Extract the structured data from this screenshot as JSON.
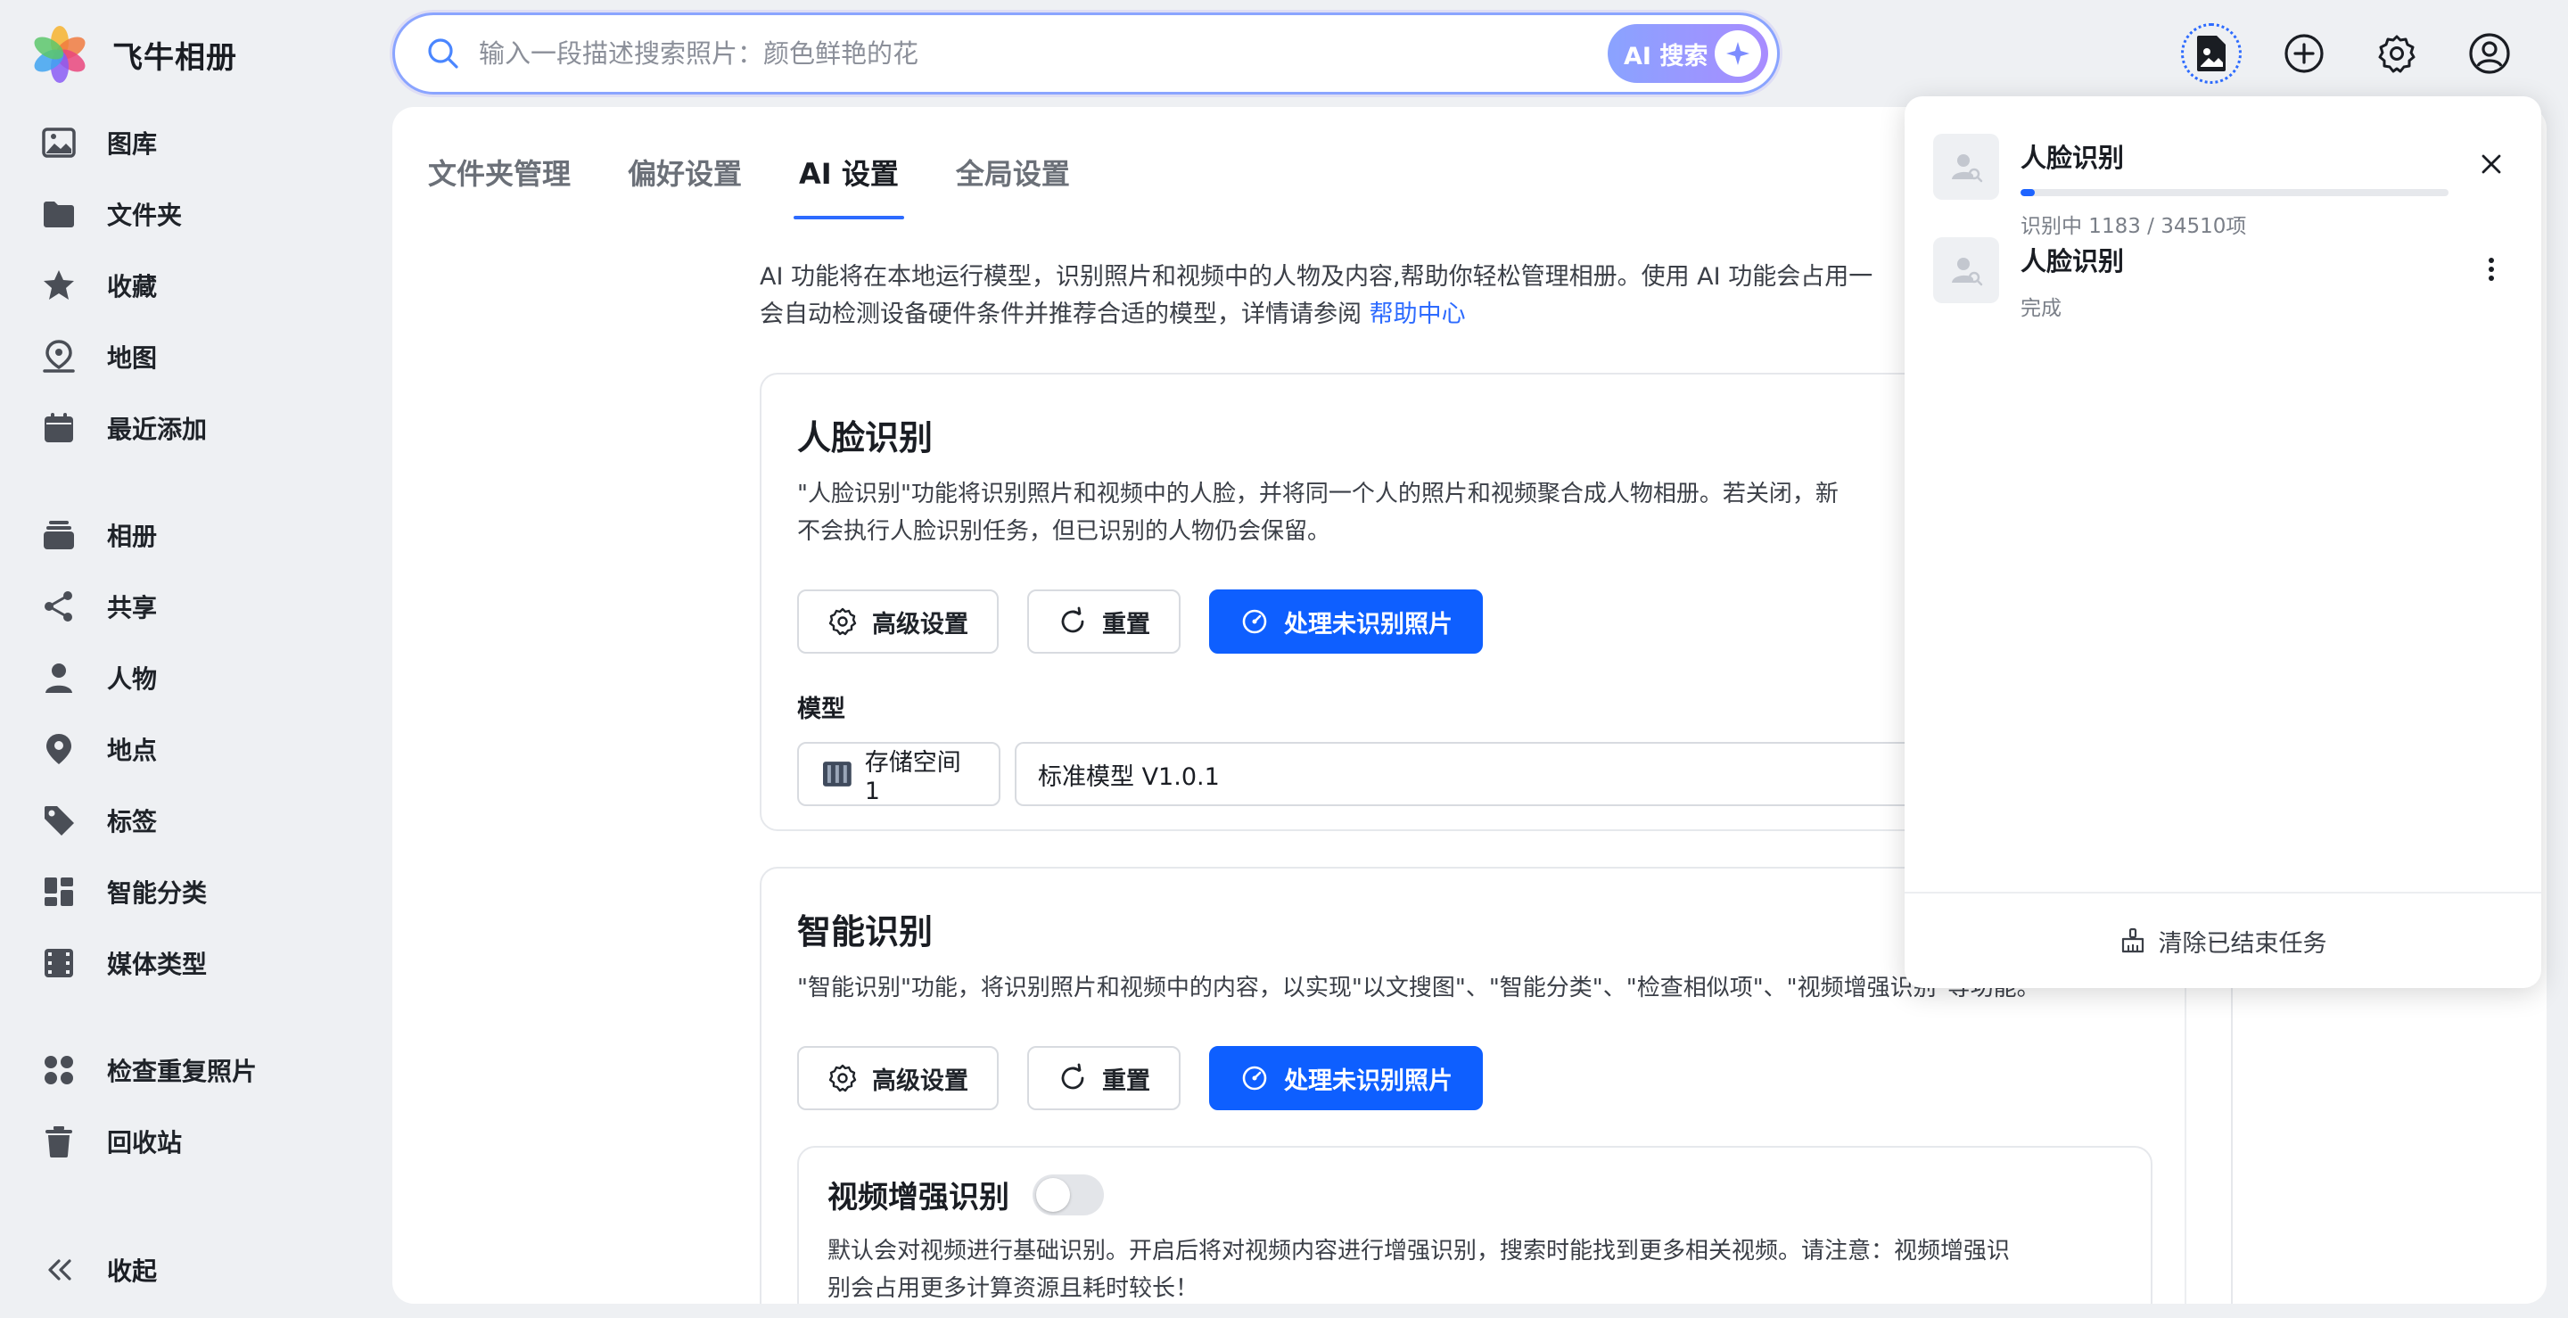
{
  "app": {
    "name": "飞牛相册"
  },
  "search": {
    "placeholder": "输入一段描述搜索照片：颜色鲜艳的花",
    "ai_label": "AI 搜索"
  },
  "sidebar": {
    "items": [
      {
        "label": "图库",
        "icon": "gallery-icon"
      },
      {
        "label": "文件夹",
        "icon": "folder-icon"
      },
      {
        "label": "收藏",
        "icon": "star-icon"
      },
      {
        "label": "地图",
        "icon": "map-icon"
      },
      {
        "label": "最近添加",
        "icon": "calendar-icon"
      },
      {
        "label": "相册",
        "icon": "album-icon"
      },
      {
        "label": "共享",
        "icon": "share-icon"
      },
      {
        "label": "人物",
        "icon": "person-icon"
      },
      {
        "label": "地点",
        "icon": "location-icon"
      },
      {
        "label": "标签",
        "icon": "tag-icon"
      },
      {
        "label": "智能分类",
        "icon": "smart-category-icon"
      },
      {
        "label": "媒体类型",
        "icon": "media-type-icon"
      },
      {
        "label": "检查重复照片",
        "icon": "duplicate-icon"
      },
      {
        "label": "回收站",
        "icon": "trash-icon"
      }
    ],
    "collapse_label": "收起"
  },
  "tabs": [
    {
      "label": "文件夹管理",
      "active": false
    },
    {
      "label": "偏好设置",
      "active": false
    },
    {
      "label": "AI 设置",
      "active": true
    },
    {
      "label": "全局设置",
      "active": false
    }
  ],
  "intro": {
    "line1": "AI 功能将在本地运行模型，识别照片和视频中的人物及内容,帮助你轻松管理相册。使用 AI 功能会占用一",
    "line2": "会自动检测设备硬件条件并推荐合适的模型，详情请参阅 ",
    "link": "帮助中心"
  },
  "face_card": {
    "title": "人脸识别",
    "desc_line1": "\"人脸识别\"功能将识别照片和视频中的人脸，并将同一个人的照片和视频聚合成人物相册。若关闭，新",
    "desc_line2": "不会执行人脸识别任务，但已识别的人物仍会保留。",
    "advanced_label": "高级设置",
    "reset_label": "重置",
    "process_label": "处理未识别照片",
    "model_label": "模型",
    "storage_label": "存储空间1",
    "model_value": "标准模型 V1.0.1"
  },
  "smart_card": {
    "title": "智能识别",
    "desc": "\"智能识别\"功能，将识别照片和视频中的内容，以实现\"以文搜图\"、\"智能分类\"、\"检查相似项\"、\"视频增强识别\"等功能。",
    "advanced_label": "高级设置",
    "reset_label": "重置",
    "process_label": "处理未识别照片",
    "video_enhance": {
      "title": "视频增强识别",
      "enabled": false,
      "desc_line1": "默认会对视频进行基础识别。开启后将对视频内容进行增强识别，搜索时能找到更多相关视频。请注意：视频增强识",
      "desc_line2": "别会占用更多计算资源且耗时较长！"
    }
  },
  "tasks": {
    "items": [
      {
        "name": "人脸识别",
        "status": "识别中 1183 / 34510项",
        "progress": 0.0343,
        "action": "close-icon"
      },
      {
        "name": "人脸识别",
        "status": "完成",
        "action": "more-icon"
      }
    ],
    "clear_label": "清除已结束任务"
  },
  "colors": {
    "accent": "#0e5fff",
    "progress": "#1e64ff",
    "link": "#2d6bff"
  }
}
